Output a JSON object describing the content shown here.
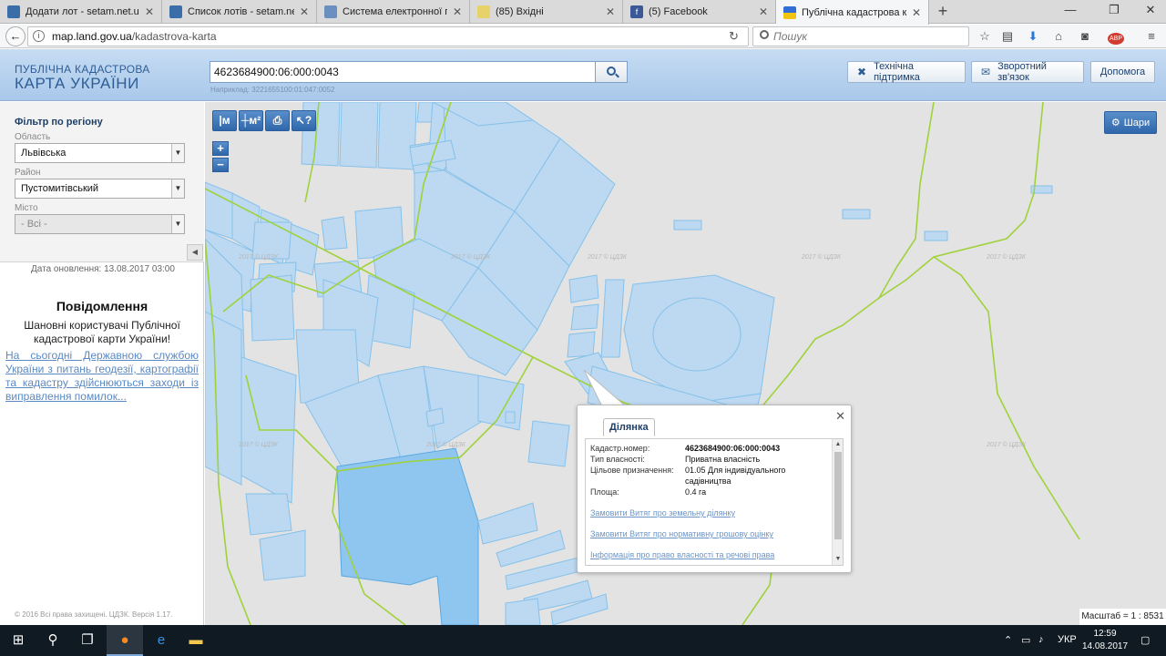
{
  "browser": {
    "tabs": [
      {
        "title": "Додати лот - setam.net.ua",
        "fav_color": "#3b6ea8"
      },
      {
        "title": "Список лотів - setam.net.ua",
        "fav_color": "#3b6ea8"
      },
      {
        "title": "Система електронної пош",
        "fav_color": "#6b8fbf"
      },
      {
        "title": "(85) Вхідні",
        "fav_color": "#e7d26a"
      },
      {
        "title": "(5) Facebook",
        "fav_color": "#3b5998"
      },
      {
        "title": "Публічна кадастрова карта",
        "fav_color": "#f1c40f"
      }
    ],
    "url_domain": "map.land.gov.ua",
    "url_path": "/kadastrova-karta",
    "search_placeholder": "Пошук"
  },
  "header": {
    "logo_line1": "ПУБЛІЧНА КАДАСТРОВА",
    "logo_line2": "КАРТА УКРАЇНИ",
    "search_value": "4623684900:06:000:0043",
    "example": "Наприклад: 3221655100:01:047:0052",
    "support_label": "Технічна підтримка",
    "feedback_label": "Зворотний зв'язок",
    "help_label": "Допомога"
  },
  "filter": {
    "title": "Фільтр по регіону",
    "oblast_label": "Область",
    "oblast_value": "Львівська",
    "district_label": "Район",
    "district_value": "Пустомитівський",
    "city_label": "Місто",
    "city_value": "- Всі -"
  },
  "panel": {
    "updated": "Дата оновлення: 13.08.2017 03:00",
    "news_title": "Повідомлення",
    "news_body": "Шановні користувачі Публічної кадастрової карти України!",
    "news_link": "На сьогодні Державною службою України з питань геодезії, картографії та кадастру здійснюються заходи із виправлення помилок...",
    "copyright": "© 2016 Всі права захищені. ЦДЗК. Версія 1.17."
  },
  "map": {
    "layers_label": "Шари",
    "scale_label": "Масштаб = 1 : 8531",
    "watermark": "2017 © ЦДЗК",
    "zoom_in": "+",
    "zoom_out": "−",
    "tool_measure": "|м",
    "tool_area": "┼м²",
    "tool_print": "⎙",
    "tool_info": "↖?"
  },
  "popup": {
    "tab": "Ділянка",
    "rows": [
      {
        "label": "Кадастр.номер:",
        "value": "4623684900:06:000:0043"
      },
      {
        "label": "Тип власності:",
        "value": "Приватна власність"
      },
      {
        "label": "Цільове призначення:",
        "value": "01.05 Для індивідуального садівництва"
      },
      {
        "label": "Площа:",
        "value": "0.4 га"
      }
    ],
    "link1": "Замовити Витяг про земельну ділянку",
    "link2": "Замовити Витяг про нормативну грошову оцінку",
    "link3": "Інформація про право власності та речові права"
  },
  "taskbar": {
    "lang": "УКР",
    "time": "12:59",
    "date": "14.08.2017"
  },
  "colors": {
    "parcel_fill": "#bcd9f1",
    "parcel_stroke": "#86c1ea",
    "boundary": "#9fd23a",
    "header_text": "#2e5d95"
  }
}
